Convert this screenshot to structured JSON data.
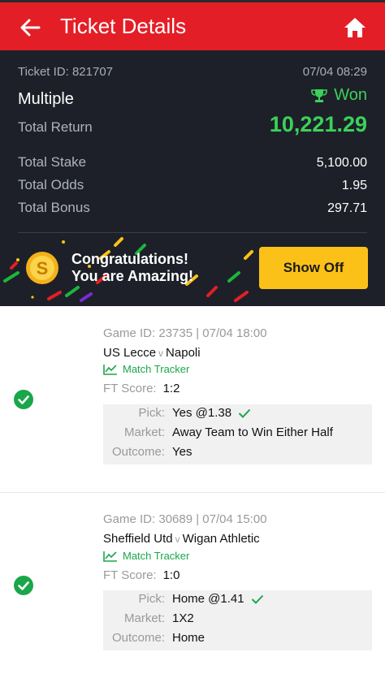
{
  "header": {
    "title": "Ticket Details",
    "back_icon": "back-arrow-icon",
    "home_icon": "home-icon"
  },
  "summary": {
    "ticket_id": "Ticket ID: 821707",
    "datetime": "07/04 08:29",
    "bet_type": "Multiple",
    "status": "Won",
    "total_return_label": "Total Return",
    "total_return": "10,221.29",
    "rows": [
      {
        "label": "Total Stake",
        "value": "5,100.00"
      },
      {
        "label": "Total Odds",
        "value": "1.95"
      },
      {
        "label": "Total Bonus",
        "value": "297.71"
      }
    ]
  },
  "banner": {
    "line1": "Congratulations!",
    "line2": "You are Amazing!",
    "button": "Show Off"
  },
  "games": [
    {
      "game_id": "Game ID: 23735 | 07/04 18:00",
      "home": "US Lecce",
      "v": "v",
      "away": "Napoli",
      "tracker": "Match Tracker",
      "score_label": "FT Score:",
      "score": "1:2",
      "pick_label": "Pick:",
      "pick": "Yes @1.38",
      "market_label": "Market:",
      "market": "Away Team to Win Either Half",
      "outcome_label": "Outcome:",
      "outcome": "Yes"
    },
    {
      "game_id": "Game ID: 30689 | 07/04 15:00",
      "home": "Sheffield Utd",
      "v": "v",
      "away": "Wigan Athletic",
      "tracker": "Match Tracker",
      "score_label": "FT Score:",
      "score": "1:0",
      "pick_label": "Pick:",
      "pick": "Home @1.41",
      "market_label": "Market:",
      "market": "1X2",
      "outcome_label": "Outcome:",
      "outcome": "Home"
    }
  ],
  "colors": {
    "brand": "#e41e26",
    "dark": "#1d2028",
    "green": "#3bd15a",
    "button": "#fcc118"
  }
}
